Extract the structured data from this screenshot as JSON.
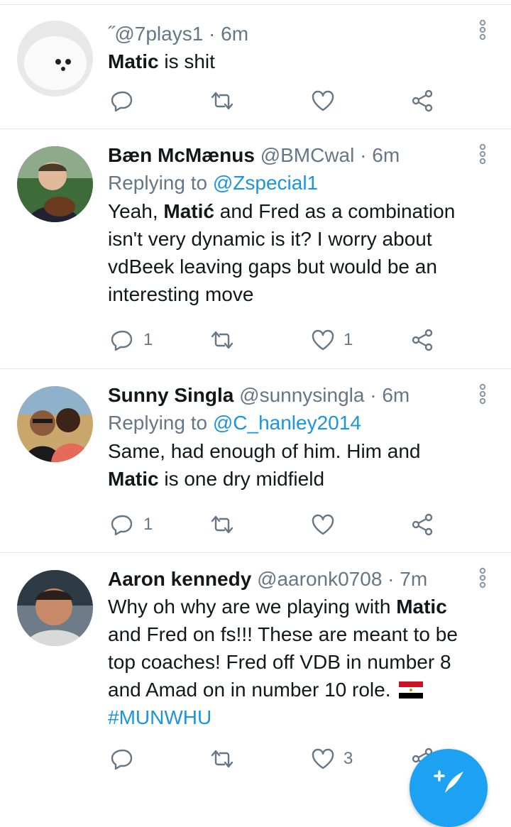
{
  "colors": {
    "link": "#1b95e0",
    "muted": "#657786",
    "accent": "#1da1f2"
  },
  "tweets": [
    {
      "name": "",
      "prefix": "˝",
      "handle": "@7plays1",
      "time": "· 6m",
      "text_bold_1": "Matic",
      "text_rest": " is shit",
      "reply_count": "",
      "retweet_count": "",
      "like_count": ""
    },
    {
      "name": "Bæn McMænus",
      "handle": "@BMCwal",
      "time": "· 6m",
      "replying_prefix": "Replying to ",
      "replying_to": "@Zspecial1",
      "text_pre": "Yeah, ",
      "text_bold": "Matić",
      "text_post": " and Fred as a combination isn't very dynamic is it? I worry about vdBeek leaving gaps but would be an interesting move",
      "reply_count": "1",
      "retweet_count": "",
      "like_count": "1"
    },
    {
      "name": "Sunny Singla",
      "handle": "@sunnysingla",
      "time": "· 6m",
      "replying_prefix": "Replying to ",
      "replying_to": "@C_hanley2014",
      "text_pre": "Same, had enough of him. Him and ",
      "text_bold": "Matic",
      "text_post": " is one dry midfield",
      "reply_count": "1",
      "retweet_count": "",
      "like_count": ""
    },
    {
      "name": "Aaron kennedy",
      "handle": "@aaronk0708",
      "time": "· 7m",
      "text_pre": "Why oh why are we playing with ",
      "text_bold": "Matic",
      "text_post": " and Fred on fs!!! These are meant to be top coaches! Fred off VDB in number 8 and Amad on in number 10 role. ",
      "hashtag": "#MUNWHU",
      "reply_count": "",
      "retweet_count": "",
      "like_count": "3"
    }
  ],
  "icons": {
    "reply": "reply-icon",
    "retweet": "retweet-icon",
    "like": "heart-icon",
    "share": "share-icon",
    "more": "more-vertical-icon",
    "compose": "compose-tweet-icon"
  }
}
